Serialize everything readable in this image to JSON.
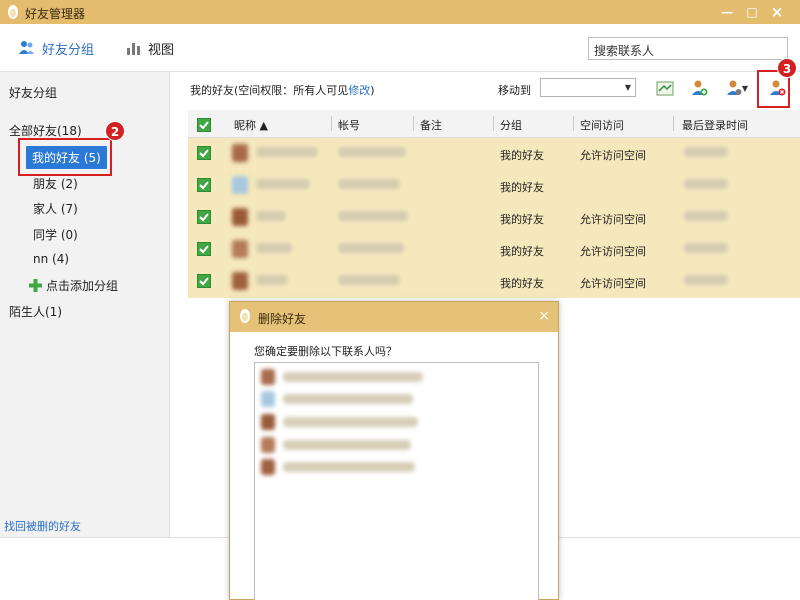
{
  "window": {
    "title": "好友管理器",
    "minimize": "—",
    "maximize": "□",
    "close": "×"
  },
  "toolbar": {
    "groups_label": "好友分组",
    "view_label": "视图",
    "search_placeholder": "搜索联系人"
  },
  "sidebar": {
    "heading": "好友分组",
    "all_friends": "全部好友(18)",
    "groups": [
      {
        "label": "我的好友 (5)",
        "selected": true
      },
      {
        "label": "朋友 (2)"
      },
      {
        "label": "家人 (7)"
      },
      {
        "label": "同学 (0)"
      },
      {
        "label": "nn (4)"
      }
    ],
    "add_group": "点击添加分组",
    "strangers": "陌生人(1)",
    "recover_link": "找回被删的好友"
  },
  "main": {
    "perm_prefix": "我的好友(空间权限：所有人可见",
    "perm_link": "修改",
    "perm_suffix": ")",
    "move_to_label": "移动到",
    "move_to_value": ""
  },
  "table": {
    "columns": [
      "昵称 ▲",
      "帐号",
      "备注",
      "分组",
      "空间访问",
      "最后登录时间"
    ],
    "rows": [
      {
        "group": "我的好友",
        "space": "允许访问空间"
      },
      {
        "group": "我的好友",
        "space": ""
      },
      {
        "group": "我的好友",
        "space": "允许访问空间"
      },
      {
        "group": "我的好友",
        "space": "允许访问空间"
      },
      {
        "group": "我的好友",
        "space": "允许访问空间"
      }
    ]
  },
  "callouts": {
    "two": "2",
    "three": "3"
  },
  "dialog": {
    "title": "删除好友",
    "close": "×",
    "question": "您确定要删除以下联系人吗？"
  },
  "colors": {
    "title_bar": "#e3bd6d",
    "row_highlight": "#f5e8bc",
    "selection_blue": "#2a79d7",
    "callout_red": "#d42020",
    "checkbox_green": "#3fa845"
  }
}
